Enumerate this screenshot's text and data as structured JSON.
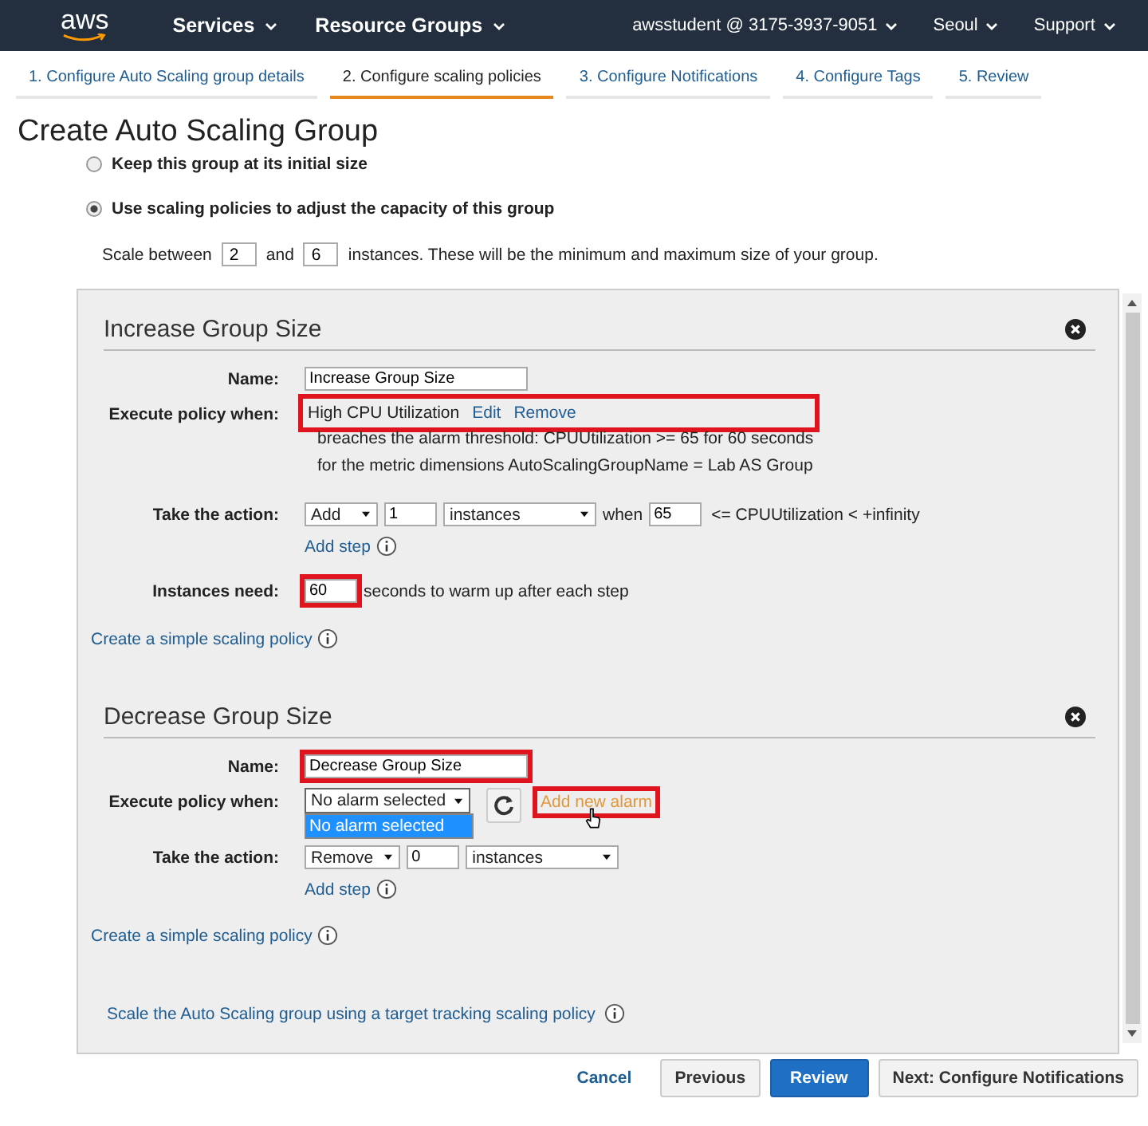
{
  "header": {
    "logo": "aws",
    "menus": [
      {
        "label": "Services"
      },
      {
        "label": "Resource Groups"
      }
    ],
    "account": "awsstudent @ 3175-3937-9051",
    "region": "Seoul",
    "support": "Support"
  },
  "steps": [
    {
      "label": "1. Configure Auto Scaling group details",
      "selected": false
    },
    {
      "label": "2. Configure scaling policies",
      "selected": true
    },
    {
      "label": "3. Configure Notifications",
      "selected": false
    },
    {
      "label": "4. Configure Tags",
      "selected": false
    },
    {
      "label": "5. Review",
      "selected": false
    }
  ],
  "title": "Create Auto Scaling Group",
  "options": [
    {
      "label": "Keep this group at its initial size",
      "selected": false
    },
    {
      "label": "Use scaling policies to adjust the capacity of this group",
      "selected": true
    }
  ],
  "scale": {
    "before": "Scale between",
    "min": "2",
    "middle": "and",
    "max": "6",
    "after": "instances. These will be the minimum and maximum size of your group."
  },
  "policies": [
    {
      "title": "Increase Group Size",
      "name_label": "Name:",
      "name": "Increase Group Size",
      "name_highlighted": false,
      "execute_label": "Execute policy when:",
      "execute": {
        "kind": "alarm",
        "alarm": "High CPU Utilization",
        "edit": "Edit",
        "remove": "Remove",
        "highlighted": true,
        "details": [
          "breaches the alarm threshold: CPUUtilization >= 65 for 60 seconds",
          "for the metric dimensions  AutoScalingGroupName = Lab AS Group"
        ]
      },
      "action_label": "Take the action:",
      "action": {
        "op": "Add",
        "count": "1",
        "unit": "instances",
        "when": "when",
        "threshold": "65",
        "condition": "<= CPUUtilization  <  +infinity"
      },
      "add_step": "Add step",
      "warmup": {
        "label": "Instances need:",
        "value": "60",
        "text": "seconds to warm up after each step",
        "highlighted": true
      },
      "link": "Create a simple scaling policy"
    },
    {
      "title": "Decrease Group Size",
      "name_label": "Name:",
      "name": "Decrease Group Size",
      "name_highlighted": true,
      "execute_label": "Execute policy when:",
      "execute": {
        "kind": "select",
        "value": "No alarm selected",
        "options": [
          {
            "label": "No alarm selected",
            "selected": true
          }
        ],
        "add_alarm": "Add new alarm",
        "highlighted": true
      },
      "action_label": "Take the action:",
      "action": {
        "op": "Remove",
        "count": "0",
        "unit": "instances"
      },
      "add_step": "Add step",
      "link": "Create a simple scaling policy"
    }
  ],
  "target_tracking": "Scale the Auto Scaling group using a target tracking scaling policy",
  "buttons": [
    {
      "label": "Cancel",
      "kind": "link"
    },
    {
      "label": "Previous",
      "kind": "default"
    },
    {
      "label": "Review",
      "kind": "primary"
    },
    {
      "label": "Next: Configure Notifications",
      "kind": "default"
    }
  ]
}
